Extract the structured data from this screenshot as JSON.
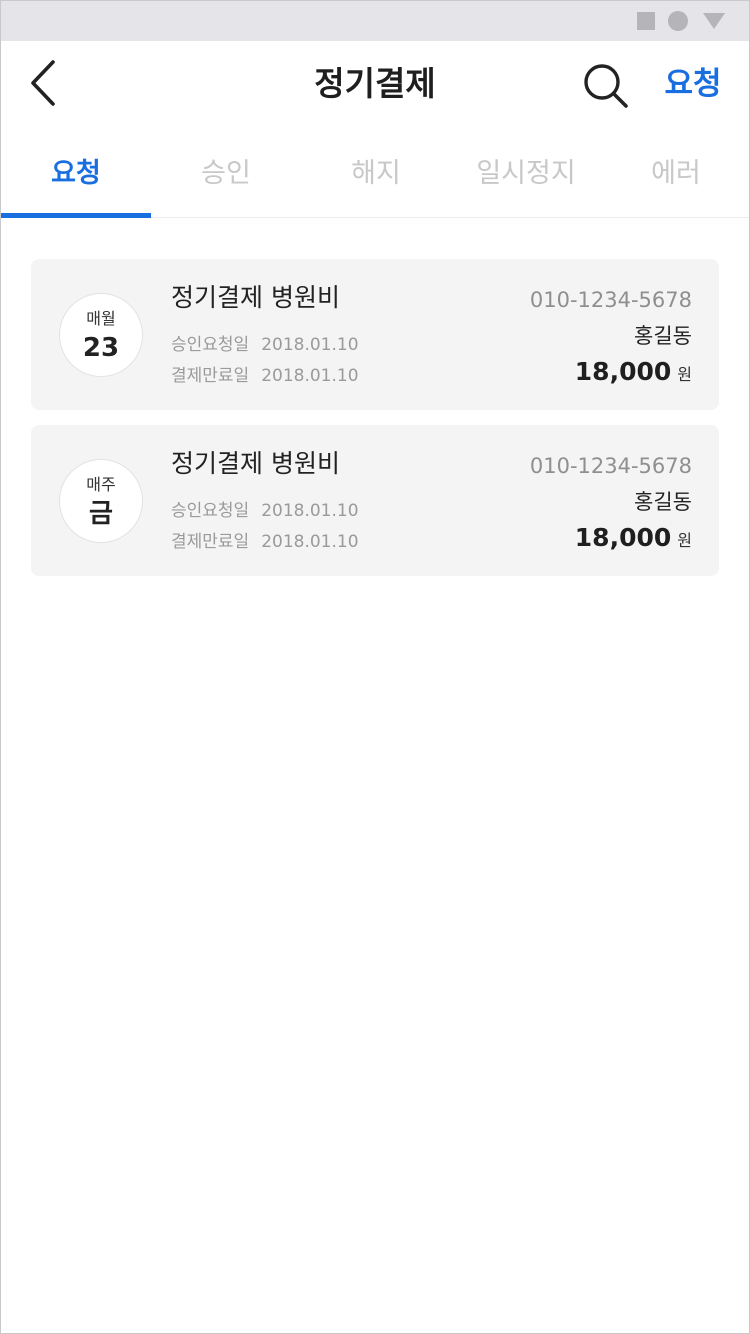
{
  "header": {
    "title": "정기결제",
    "back_icon": "chevron-left-icon",
    "search_icon": "search-icon",
    "request_label": "요청"
  },
  "tabs": [
    {
      "label": "요청",
      "active": true
    },
    {
      "label": "승인",
      "active": false
    },
    {
      "label": "해지",
      "active": false
    },
    {
      "label": "일시정지",
      "active": false
    },
    {
      "label": "에러",
      "active": false
    }
  ],
  "cards": [
    {
      "cycle_label": "매월",
      "cycle_value": "23",
      "title": "정기결제 병원비",
      "request_label": "승인요청일",
      "request_date": "2018.01.10",
      "expire_label": "결제만료일",
      "expire_date": "2018.01.10",
      "phone": "010-1234-5678",
      "customer": "홍길동",
      "amount": "18,000",
      "currency": "원"
    },
    {
      "cycle_label": "매주",
      "cycle_value": "금",
      "title": "정기결제 병원비",
      "request_label": "승인요청일",
      "request_date": "2018.01.10",
      "expire_label": "결제만료일",
      "expire_date": "2018.01.10",
      "phone": "010-1234-5678",
      "customer": "홍길동",
      "amount": "18,000",
      "currency": "원"
    }
  ],
  "colors": {
    "accent": "#1a6fe0",
    "inactive_tab": "#c8c8c8",
    "card_bg": "#f4f4f4",
    "status_bar": "#e4e4e9"
  }
}
